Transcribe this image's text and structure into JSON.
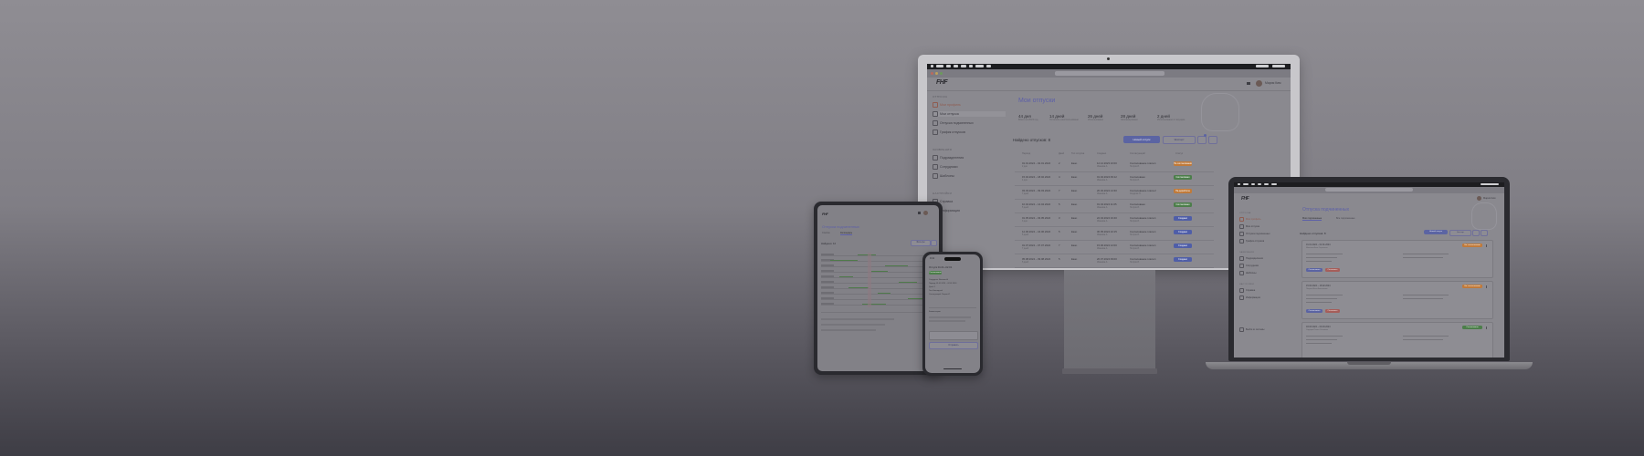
{
  "desktop": {
    "menubar": [
      "Finder",
      "File",
      "Edit",
      "View",
      "Go",
      "Window",
      "Help"
    ],
    "menubar_right": "Fri 9:41 AM",
    "logo": "FHF",
    "user": "Мария Ким",
    "sidebar": {
      "group1": "ОТПУСКА",
      "items1": [
        "Мои профиль",
        "Мои отпуска",
        "Отпуска подчиненных",
        "График отпусков"
      ],
      "group2": "ЗАЯВЛЕНИЯ",
      "items2": [
        "Подразделения",
        "Сотрудники",
        "Шаблоны"
      ],
      "group3": "НАСТРОЙКИ",
      "items3": [
        "Справка",
        "Информация"
      ]
    },
    "page_title": "Мои отпуски",
    "stats": [
      {
        "value": "44 дня",
        "label": "Всего на 2024 год"
      },
      {
        "value": "14 дней",
        "label": "Осталось неиспользовано"
      },
      {
        "value": "26 дней",
        "label": "Использовано"
      },
      {
        "value": "28 дней",
        "label": "Запланировано"
      },
      {
        "value": "2 дней",
        "label": "Использовано в текущем"
      }
    ],
    "section_title": "Найдено отпусков: 8",
    "btn_new": "Новый отпуск",
    "btn_export": "Экспорт",
    "columns": [
      "Период",
      "Дней",
      "Тип отпуска",
      "Создано",
      "Согласующий",
      "Статус"
    ],
    "rows": [
      {
        "period": "01.01.2024 – 02.01.2024",
        "sub": "2 дня",
        "days": "2",
        "type": "Ежег.",
        "created": "12.12.2023 10:00",
        "created_sub": "Иванова А.",
        "approver": "Согласование этапа 1",
        "approver_sub": "Петров И.",
        "status": "На согласовании",
        "status_color": "#c07a3a"
      },
      {
        "period": "15.02.2024 – 18.02.2024",
        "sub": "4 дня",
        "days": "4",
        "type": "Ежег.",
        "created": "01.02.2024 09:12",
        "created_sub": "Иванова А.",
        "approver": "Согласовано",
        "approver_sub": "Петров И.",
        "status": "Согласовано",
        "status_color": "#4c7e4a"
      },
      {
        "period": "03.03.2024 – 09.03.2024",
        "sub": "7 дней",
        "days": "7",
        "type": "Ежег.",
        "created": "20.02.2024 14:30",
        "created_sub": "Иванова А.",
        "approver": "Согласование этапа 2",
        "approver_sub": "Сидоров П.",
        "status": "На доработке",
        "status_color": "#c07a3a"
      },
      {
        "period": "10.04.2024 – 14.04.2024",
        "sub": "5 дней",
        "days": "5",
        "type": "Ежег.",
        "created": "01.04.2024 11:05",
        "created_sub": "Иванова А.",
        "approver": "Согласовано",
        "approver_sub": "Петров И.",
        "status": "Согласовано",
        "status_color": "#4c7e4a"
      },
      {
        "period": "01.05.2024 – 03.05.2024",
        "sub": "3 дня",
        "days": "3",
        "type": "Ежег.",
        "created": "22.04.2024 16:40",
        "created_sub": "Иванова А.",
        "approver": "Согласование этапа 1",
        "approver_sub": "Петров И.",
        "status": "Создано",
        "status_color": "#4f5ea8"
      },
      {
        "period": "12.06.2024 – 16.06.2024",
        "sub": "5 дней",
        "days": "5",
        "type": "Ежег.",
        "created": "30.05.2024 10:15",
        "created_sub": "Иванова А.",
        "approver": "Согласование этапа 1",
        "approver_sub": "Петров И.",
        "status": "Создано",
        "status_color": "#4f5ea8"
      },
      {
        "period": "01.07.2024 – 07.07.2024",
        "sub": "7 дней",
        "days": "7",
        "type": "Ежег.",
        "created": "15.06.2024 12:00",
        "created_sub": "Иванова А.",
        "approver": "Согласование этапа 1",
        "approver_sub": "Петров И.",
        "status": "Создано",
        "status_color": "#4f5ea8"
      },
      {
        "period": "05.08.2024 – 09.08.2024",
        "sub": "5 дней",
        "days": "5",
        "type": "Ежег.",
        "created": "20.07.2024 09:00",
        "created_sub": "Иванова А.",
        "approver": "Согласование этапа 1",
        "approver_sub": "Петров И.",
        "status": "Создано",
        "status_color": "#4f5ea8"
      }
    ]
  },
  "tablet": {
    "logo": "FHF",
    "title": "Отпуска подчиненных",
    "tabs": [
      "Список",
      "Календарь"
    ],
    "section": "Найдено: 12",
    "btn": "Фильтры"
  },
  "phone": {
    "time": "9:41",
    "title": "Отпуск 01.01–02.01",
    "status": "Согласовано",
    "lines": [
      "Сотрудник: Иванова А.",
      "Период: 01.01.2024 – 02.01.2024",
      "Дней: 2",
      "Тип: Ежегодный",
      "Согласующий: Петров И."
    ],
    "comments_title": "Комментарии",
    "btn": "Отправить"
  },
  "laptop": {
    "logo": "FHF",
    "user": "Мария Ким",
    "sidebar": {
      "group1": "ОТПУСКА",
      "items1": [
        "Мои профиль",
        "Мои отпуска",
        "Отпуска подчиненных",
        "График отпусков"
      ],
      "group2": "ЗАЯВЛЕНИЯ",
      "items2": [
        "Подразделения",
        "Сотрудники",
        "Шаблоны"
      ],
      "group3": "НАСТРОЙКИ",
      "items3": [
        "Справка",
        "Информация"
      ],
      "footer": "Выйти из системы"
    },
    "page_title": "Отпуска подчиненных",
    "tabs": [
      "Мои подчиненные",
      "Все подчиненные"
    ],
    "section_title": "Найдено отпусков: 8",
    "btn_new": "Новый отпуск",
    "btn_export": "Экспорт",
    "cards": [
      {
        "period": "01.01.2024 – 02.01.2024",
        "name": "Иванова Анна Сергеевна",
        "status": "На согласовании",
        "status_color": "#c07a3a",
        "approve": "Согласовать",
        "reject": "Отклонить"
      },
      {
        "period": "15.02.2024 – 18.02.2024",
        "name": "Петров Иван Алексеевич",
        "status": "На согласовании",
        "status_color": "#c07a3a",
        "approve": "Согласовать",
        "reject": "Отклонить"
      },
      {
        "period": "03.03.2024 – 09.03.2024",
        "name": "Сидоров Павел Олегович",
        "status": "Согласовано",
        "status_color": "#4c7e4a",
        "approve": "",
        "reject": ""
      }
    ]
  }
}
